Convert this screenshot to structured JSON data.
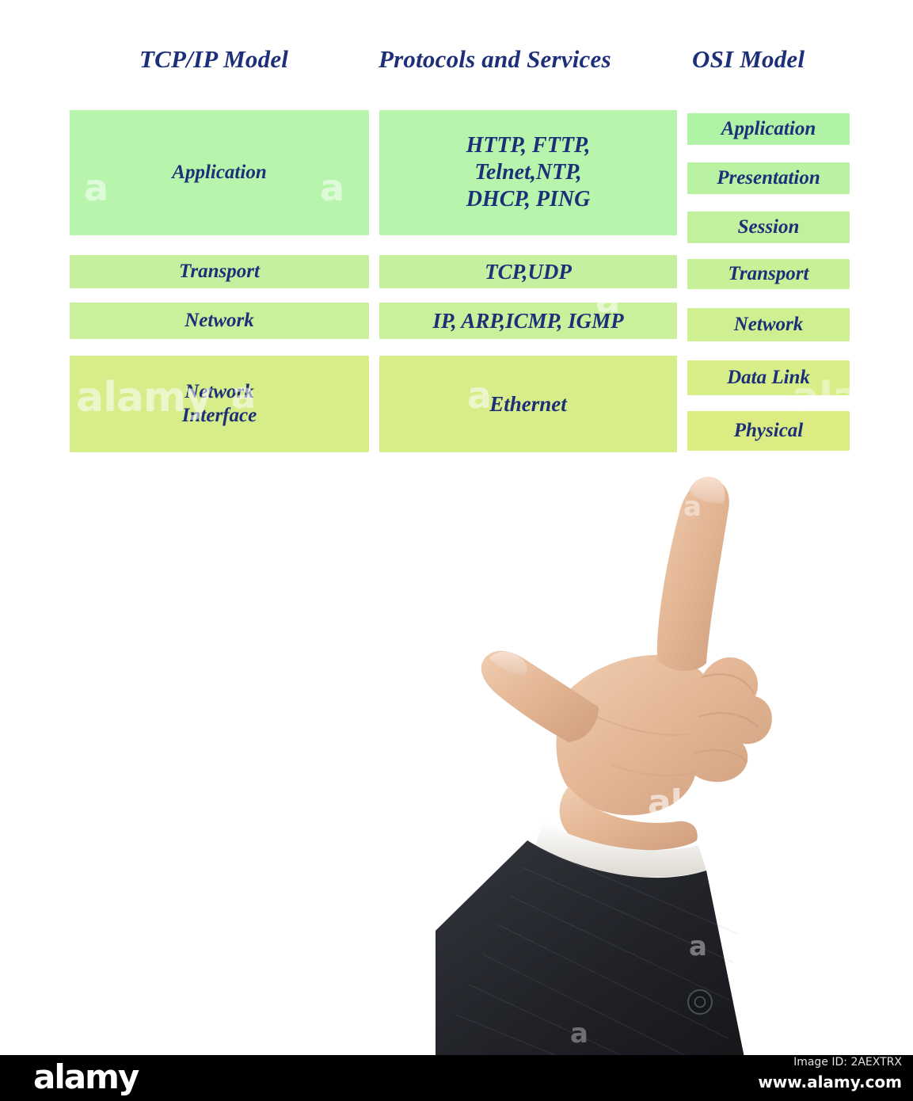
{
  "headers": {
    "tcpip": "TCP/IP Model",
    "protocols": "Protocols and Services",
    "osi": "OSI Model"
  },
  "colors": {
    "text_navy": "#1c2f78",
    "box_green_light": "#b6f5ab",
    "box_green_mid": "#c6f0a0",
    "box_yellow_green": "#d7ed8a",
    "footer_bg": "#000000",
    "skin": "#e6bc9c",
    "suit": "#24262b"
  },
  "tcpip_layers": [
    {
      "label": "Application"
    },
    {
      "label": "Transport"
    },
    {
      "label": "Network"
    },
    {
      "label_line1": "Network",
      "label_line2": "Interface"
    }
  ],
  "protocols": [
    {
      "line1": "HTTP, FTTP,",
      "line2": "Telnet,NTP,",
      "line3": "DHCP, PING"
    },
    {
      "line1": "TCP,UDP"
    },
    {
      "line1": "IP, ARP,ICMP, IGMP"
    },
    {
      "line1": "Ethernet"
    }
  ],
  "osi_layers": [
    {
      "label": "Application"
    },
    {
      "label": "Presentation"
    },
    {
      "label": "Session"
    },
    {
      "label": "Transport"
    },
    {
      "label": "Network"
    },
    {
      "label": "Data Link"
    },
    {
      "label": "Physical"
    }
  ],
  "watermarks": {
    "letter": "a",
    "word": "alamy"
  },
  "footer": {
    "logo": "alamy",
    "image_id": "Image ID: 2AEXTRX",
    "url": "www.alamy.com"
  }
}
